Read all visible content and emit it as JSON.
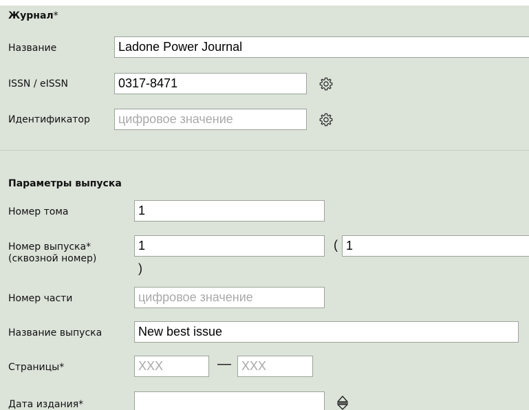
{
  "journal": {
    "title": "Журнал",
    "required_mark": "*",
    "name": {
      "label": "Название",
      "value": "Ladone Power Journal"
    },
    "issn": {
      "label": "ISSN / eISSN",
      "value": "0317-8471"
    },
    "identifier": {
      "label": "Идентификатор",
      "value": "",
      "placeholder": "цифровое значение"
    }
  },
  "issue": {
    "title": "Параметры выпуска",
    "volume": {
      "label": "Номер тома",
      "value": "1"
    },
    "issue_number": {
      "label_line1": "Номер выпуска*",
      "label_line2": "(сквозной номер)",
      "value": "1",
      "open_paren": "(",
      "close_paren": ")",
      "continuous_value": "1"
    },
    "part_number": {
      "label": "Номер части",
      "value": "",
      "placeholder": "цифровое значение"
    },
    "issue_name": {
      "label": "Название выпуска",
      "value": "New best issue"
    },
    "pages": {
      "label": "Страницы*",
      "from_placeholder": "XXX",
      "to_placeholder": "XXX",
      "separator": "—"
    },
    "publish_date": {
      "label": "Дата издания*",
      "value": ""
    }
  },
  "icons": {
    "issn_lookup": "gear-icon",
    "identifier_lookup": "gear-icon",
    "date_picker": "up-down-arrows-icon"
  }
}
